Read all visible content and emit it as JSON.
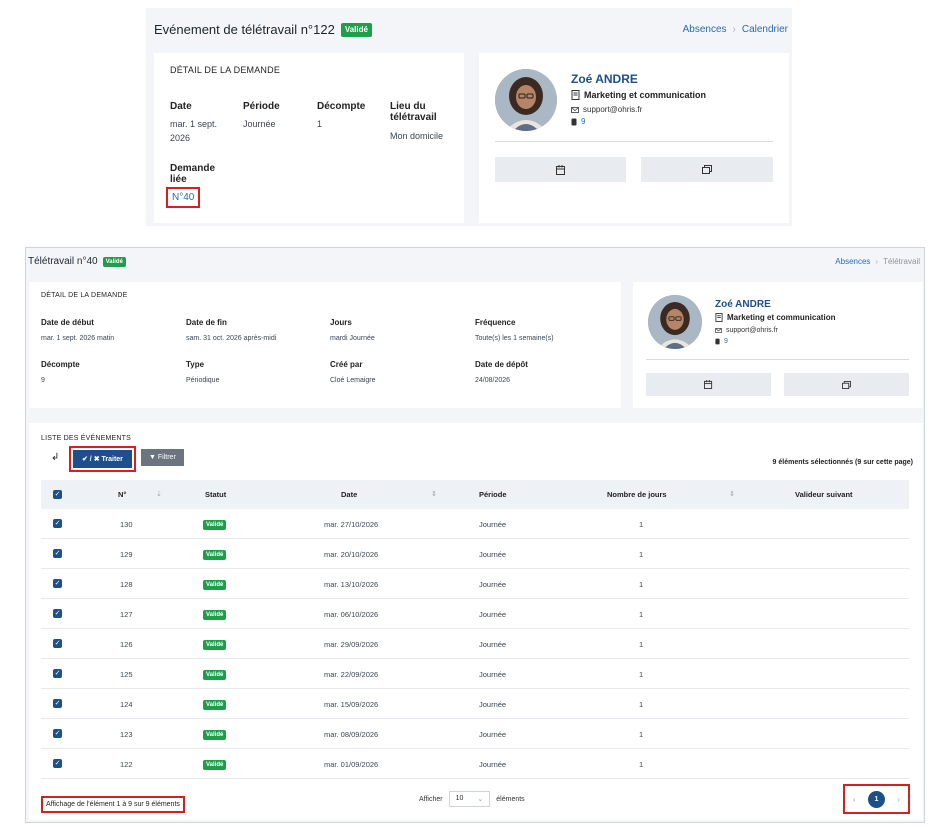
{
  "top": {
    "title": "Evénement de télétravail n°122",
    "status": "Validé",
    "breadcrumb": [
      "Absences",
      "Calendrier"
    ],
    "detail": {
      "header": "DÉTAIL DE LA DEMANDE",
      "date_label": "Date",
      "date_value_1": "mar. 1 sept.",
      "date_value_2": "2026",
      "periode_label": "Période",
      "periode_value": "Journée",
      "decompte_label": "Décompte",
      "decompte_value": "1",
      "lieu_label_1": "Lieu du",
      "lieu_label_2": "télétravail",
      "lieu_value": "Mon domicile",
      "demande_label_1": "Demande",
      "demande_label_2": "liée",
      "demande_link": "N°40"
    },
    "profile": {
      "name": "Zoé ANDRE",
      "department": "Marketing et communication",
      "email": "support@ohris.fr",
      "count": "9"
    }
  },
  "bottom": {
    "title": "Télétravail n°40",
    "status": "Validé",
    "breadcrumb": [
      "Absences",
      "Télétravail"
    ],
    "detail": {
      "header": "DÉTAIL DE LA DEMANDE",
      "fields": [
        {
          "label": "Date de début",
          "value": "mar. 1 sept. 2026 matin"
        },
        {
          "label": "Date de fin",
          "value": "sam. 31 oct. 2026 après-midi"
        },
        {
          "label": "Jours",
          "value": "mardi Journée"
        },
        {
          "label": "Fréquence",
          "value": "Toute(s) les 1 semaine(s)"
        },
        {
          "label": "Décompte",
          "value": "9"
        },
        {
          "label": "Type",
          "value": "Périodique"
        },
        {
          "label": "Créé par",
          "value": "Cloé Lemaigre"
        },
        {
          "label": "Date de dépôt",
          "value": "24/08/2026"
        }
      ]
    },
    "profile": {
      "name": "Zoé ANDRE",
      "department": "Marketing et communication",
      "email": "support@ohris.fr",
      "count": "9"
    },
    "events": {
      "header": "LISTE DES ÉVÉNEMENTS",
      "traiter_label": "✔ / ✖ Traiter",
      "filtrer_label": "Filtrer",
      "selection_info": "9 éléments sélectionnés (9 sur cette page)",
      "columns": [
        "N°",
        "Statut",
        "Date",
        "Période",
        "Nombre de jours",
        "Valideur suivant"
      ],
      "rows": [
        {
          "num": "130",
          "status": "Validé",
          "date": "mar. 27/10/2026",
          "periode": "Journée",
          "jours": "1",
          "valideur": ""
        },
        {
          "num": "129",
          "status": "Validé",
          "date": "mar. 20/10/2026",
          "periode": "Journée",
          "jours": "1",
          "valideur": ""
        },
        {
          "num": "128",
          "status": "Validé",
          "date": "mar. 13/10/2026",
          "periode": "Journée",
          "jours": "1",
          "valideur": ""
        },
        {
          "num": "127",
          "status": "Validé",
          "date": "mar. 06/10/2026",
          "periode": "Journée",
          "jours": "1",
          "valideur": ""
        },
        {
          "num": "126",
          "status": "Validé",
          "date": "mar. 29/09/2026",
          "periode": "Journée",
          "jours": "1",
          "valideur": ""
        },
        {
          "num": "125",
          "status": "Validé",
          "date": "mar. 22/09/2026",
          "periode": "Journée",
          "jours": "1",
          "valideur": ""
        },
        {
          "num": "124",
          "status": "Validé",
          "date": "mar. 15/09/2026",
          "periode": "Journée",
          "jours": "1",
          "valideur": ""
        },
        {
          "num": "123",
          "status": "Validé",
          "date": "mar. 08/09/2026",
          "periode": "Journée",
          "jours": "1",
          "valideur": ""
        },
        {
          "num": "122",
          "status": "Validé",
          "date": "mar. 01/09/2026",
          "periode": "Journée",
          "jours": "1",
          "valideur": ""
        }
      ],
      "footer_info": "Affichage de l'élément 1 à 9 sur 9 éléments",
      "afficher_label": "Afficher",
      "page_size": "10",
      "elements_label": "éléments",
      "current_page": "1"
    }
  },
  "colors": {
    "brand": "#1d4f8a",
    "success": "#1f9e4a",
    "highlight": "#d32020",
    "link": "#2b6cb0"
  },
  "icons": [
    "check-icon",
    "filter-icon",
    "sort-icon",
    "envelope-icon",
    "badge-icon",
    "document-icon",
    "calendar-icon",
    "window-icon",
    "chevron-left-icon",
    "chevron-right-icon",
    "chevron-down-icon",
    "corner-arrow-icon"
  ]
}
